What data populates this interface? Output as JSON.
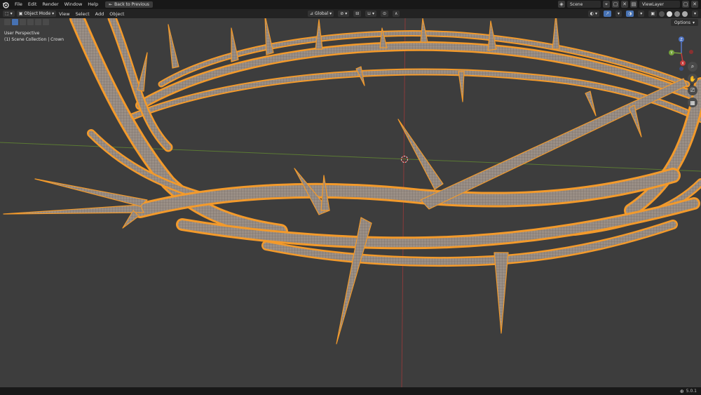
{
  "menu": {
    "items": [
      "File",
      "Edit",
      "Render",
      "Window",
      "Help"
    ],
    "back_button": "Back to Previous"
  },
  "top_right": {
    "scene": "Scene",
    "view_layer": "ViewLayer"
  },
  "viewport_header": {
    "mode": "Object Mode",
    "items": [
      "View",
      "Select",
      "Add",
      "Object"
    ],
    "orientation": "Global"
  },
  "viewport": {
    "perspective": "User Perspective",
    "collection": "(1) Scene Collection | Crown",
    "options_label": "Options",
    "selection_color": "#f39a2b"
  },
  "gizmo": {
    "z": "Z",
    "y": "Y",
    "x": "X"
  },
  "status": {
    "version": "5.0.1"
  },
  "icons": [
    "blender-logo",
    "back-icon",
    "pin-icon",
    "editor-type-icon",
    "object-mode-icon",
    "transform-orientation-icon",
    "snap-icon",
    "proportional-icon",
    "visibility-icon",
    "gizmo-icon",
    "overlay-icon",
    "xray-icon",
    "shading-icon",
    "zoom-icon",
    "hand-icon",
    "camera-icon",
    "grid-icon",
    "globe-icon"
  ]
}
